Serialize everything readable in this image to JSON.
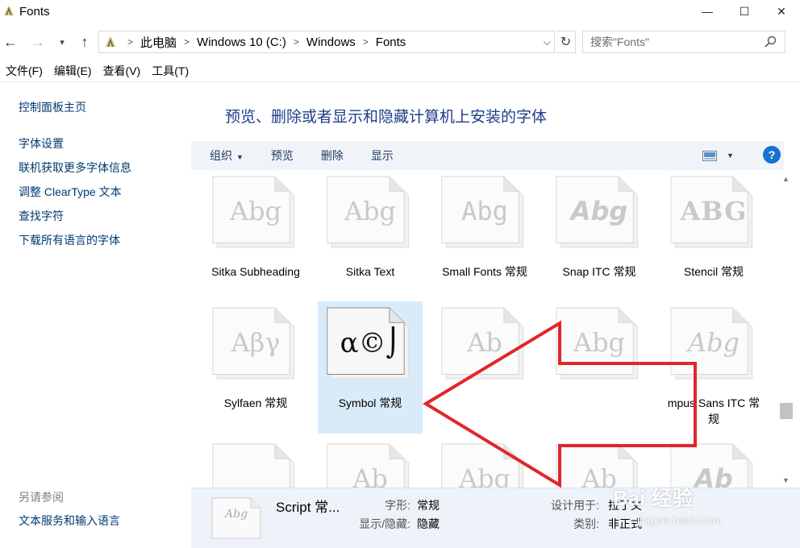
{
  "window": {
    "title": "Fonts",
    "minimize": "—",
    "maximize": "☐",
    "close": "✕"
  },
  "nav": {
    "breadcrumbs": [
      "此电脑",
      "Windows 10 (C:)",
      "Windows",
      "Fonts"
    ],
    "search_placeholder": "搜索\"Fonts\""
  },
  "menu": [
    "文件(F)",
    "编辑(E)",
    "查看(V)",
    "工具(T)"
  ],
  "sidebar": {
    "home": "控制面板主页",
    "links": [
      "字体设置",
      "联机获取更多字体信息",
      "调整 ClearType 文本",
      "查找字符",
      "下载所有语言的字体"
    ],
    "see_also_title": "另请参阅",
    "see_also_links": [
      "文本服务和输入语言"
    ]
  },
  "main": {
    "heading": "预览、删除或者显示和隐藏计算机上安装的字体",
    "commands": {
      "organize": "组织",
      "preview": "预览",
      "delete": "删除",
      "show": "显示"
    },
    "help": "?"
  },
  "fonts": [
    {
      "name": "Sitka Subheading",
      "sample": "Abg",
      "style": "serif"
    },
    {
      "name": "Sitka Text",
      "sample": "Abg",
      "style": "serif"
    },
    {
      "name": "Small Fonts 常规",
      "sample": "Abg",
      "style": "pixel"
    },
    {
      "name": "Snap ITC 常规",
      "sample": "Abg",
      "style": "bold"
    },
    {
      "name": "Stencil 常规",
      "sample": "ABG",
      "style": "stencil"
    },
    {
      "name": "Sylfaen 常规",
      "sample": "Aβγ",
      "style": "serif"
    },
    {
      "name": "Symbol 常规",
      "sample": "α©⌡",
      "style": "symbol",
      "selected": true
    },
    {
      "name": "",
      "sample": "Ab",
      "style": "serif"
    },
    {
      "name": "",
      "sample": "Abg",
      "style": "serif"
    },
    {
      "name": "mpus Sans ITC 常规",
      "sample": "Abg",
      "style": "script"
    },
    {
      "name": "",
      "sample": "",
      "style": "serif"
    },
    {
      "name": "",
      "sample": "Ab",
      "style": "serif"
    },
    {
      "name": "",
      "sample": "Abg",
      "style": "serif"
    },
    {
      "name": "",
      "sample": "Ab",
      "style": "serif"
    },
    {
      "name": "",
      "sample": "Ab",
      "style": "bold"
    }
  ],
  "details": {
    "name": "Script 常...",
    "thumb_sample": "Abg",
    "style_label": "字形:",
    "style_value": "常规",
    "visibility_label": "显示/隐藏:",
    "visibility_value": "隐藏",
    "designed_for_label": "设计用于:",
    "designed_for_value": "拉丁文",
    "category_label": "类别:",
    "category_value": "非正式"
  },
  "watermark": {
    "brand": "Bai 经验",
    "url": "jingyan.baidu.com"
  },
  "colors": {
    "heading": "#1e3e8a",
    "link": "#003a70",
    "cmdbar": "#f0f4f9",
    "selected": "#d9ebf9",
    "arrow": "#e0262b"
  }
}
